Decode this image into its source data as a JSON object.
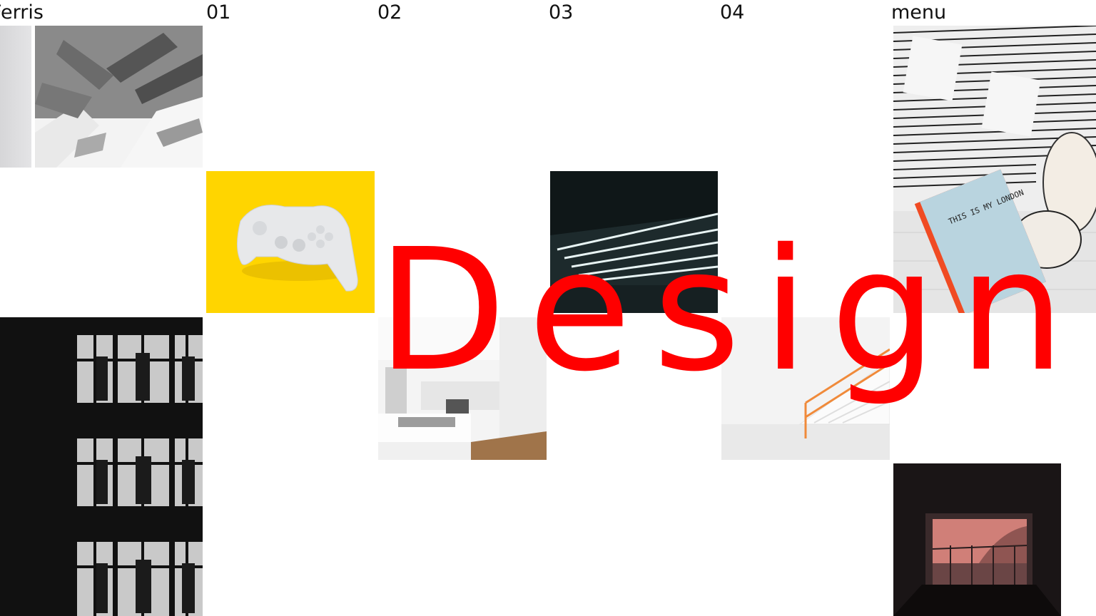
{
  "nav": {
    "brand": "Ferris",
    "items": [
      "01",
      "02",
      "03",
      "04"
    ],
    "menu_label": "menu"
  },
  "hero": {
    "word": "Design"
  },
  "colors": {
    "accent": "#ff0000",
    "yellow": "#ffd500",
    "dark": "#111111"
  },
  "book_title": "THIS IS MY LONDON"
}
